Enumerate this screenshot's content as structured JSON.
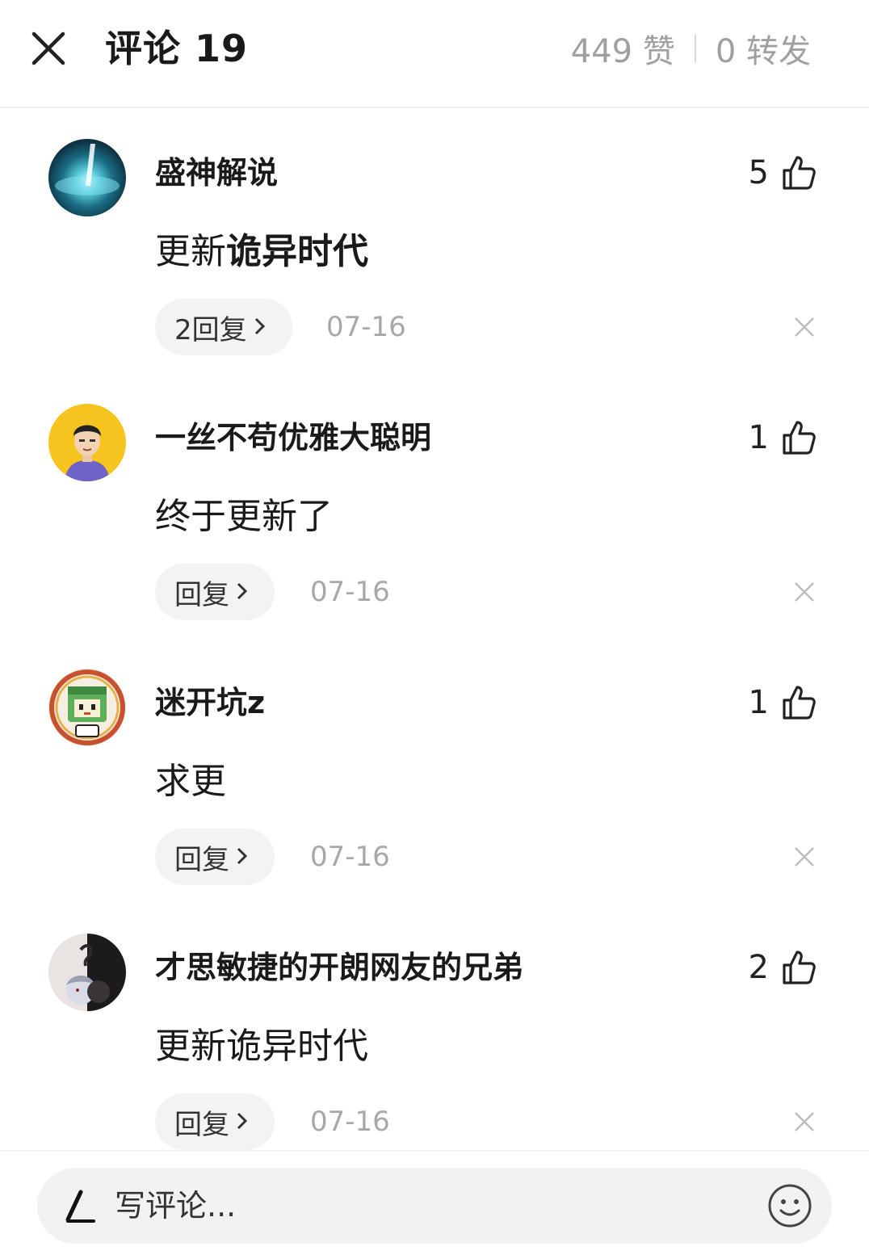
{
  "header": {
    "title": "评论 19",
    "likes": "449 赞",
    "shares": "0 转发"
  },
  "comments": [
    {
      "username": "盛神解说",
      "text_plain": "更新",
      "text_bold": "诡异时代",
      "like_count": "5",
      "reply_label": "2回复",
      "date": "07-16",
      "avatar": "galaxy-avatar"
    },
    {
      "username": "一丝不苟优雅大聪明",
      "text_plain": "终于更新了",
      "text_bold": "",
      "like_count": "1",
      "reply_label": "回复",
      "date": "07-16",
      "avatar": "cartoon-boy-avatar"
    },
    {
      "username": "迷开坑z",
      "text_plain": "求更",
      "text_bold": "",
      "like_count": "1",
      "reply_label": "回复",
      "date": "07-16",
      "avatar": "block-character-avatar"
    },
    {
      "username": "才思敏捷的开朗网友的兄弟",
      "text_plain": "更新诡异时代",
      "text_bold": "",
      "like_count": "2",
      "reply_label": "回复",
      "date": "07-16",
      "avatar": "anime-ink-avatar"
    }
  ],
  "composer": {
    "placeholder": "写评论..."
  },
  "colors": {
    "pill_bg": "#f2f2f2",
    "muted_text": "#a8a8a8",
    "divider": "#f0f0f0"
  }
}
